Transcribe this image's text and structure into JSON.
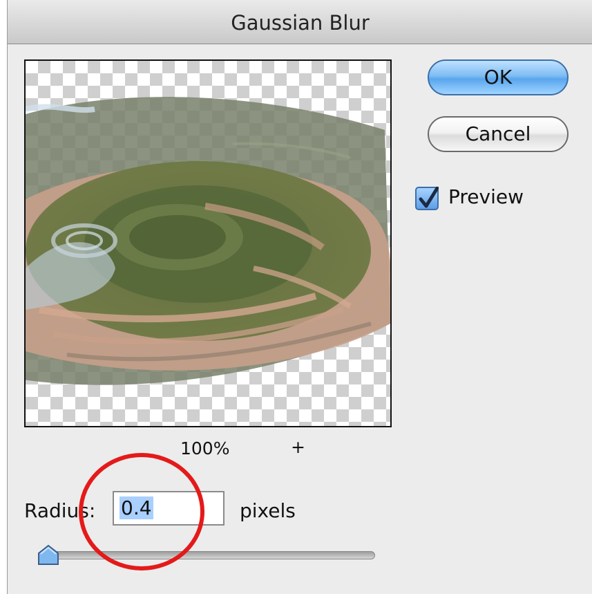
{
  "dialog": {
    "title": "Gaussian Blur",
    "ok_label": "OK",
    "cancel_label": "Cancel",
    "preview_checkbox": {
      "label": "Preview",
      "checked": true
    }
  },
  "preview": {
    "zoom": "100%",
    "zoom_in_label": "+"
  },
  "radius": {
    "label": "Radius:",
    "value": "0.4",
    "unit": "pixels",
    "slider_fraction": 0.004
  },
  "colors": {
    "accent": "#5aa6ee",
    "annotation": "#e41a1a",
    "background": "#ececec"
  },
  "icons": {
    "checkbox": "checkmark-icon",
    "slider_thumb": "slider-thumb-icon"
  }
}
